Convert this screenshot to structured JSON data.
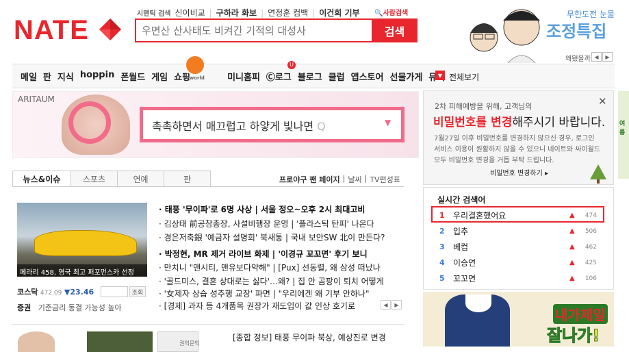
{
  "header": {
    "logo": "NATE",
    "hot_label": "시맨틱 검색",
    "hot_terms": [
      "신이비교",
      "구하라 화보",
      "연정훈 컴백",
      "이건희 기부"
    ],
    "people_search": "사람검색",
    "search_placeholder": "우면산 산사태도 비켜간 기적의 대성사",
    "search_button": "검색"
  },
  "promo": {
    "subtitle": "무한도전 눈물",
    "title": "조정특집",
    "link": "왜됐을까",
    "prev": "◀",
    "next": "▶"
  },
  "nav": {
    "items": [
      "메일",
      "판",
      "지식",
      "hoppin",
      "폰월드",
      "게임",
      "쇼핑",
      "미니홈피",
      "Ⓒ로그",
      "블로그",
      "클럽",
      "앱스토어",
      "선물가게",
      "뮤직"
    ],
    "cyworld_label": "cyworld",
    "blog_badge": "U",
    "all_icon": "▼",
    "all_label": "전체보기"
  },
  "banner": {
    "brand": "ARITAUM",
    "text": "촉촉하면서 매끄럽고 하얗게 빛나면",
    "search_glyph": "Q",
    "caret": "▼"
  },
  "tabs": {
    "items": [
      "뉴스&이슈",
      "스포츠",
      "연예",
      "판"
    ],
    "right": [
      "프로야구 팬 페이지",
      "날씨",
      "TV편성표"
    ]
  },
  "news": {
    "image_caption": "페라리 458, 영국 최고 퍼포먼스카 선정",
    "headlines": [
      "· 태풍 '무이파'로 6명 사상 | 서울 정오~오후 2시 최대고비",
      "· 김상태 前공참총장, 사설비행장 운영 | '플라스틱 탄피' 나온다",
      "· 경은저축銀 '예금자 설명회' 북새통 | 국내 보안SW 北이 만든다?",
      "· 박정현, MR 제거 라이브 화제 | '이경규 꼬꼬면' 후기 보니",
      "· 만치니 \"맨시티, 맨유보다약해\" | [Pux] 선동렬, 왜 삼성 떠났나",
      "· '골드미스, 결혼 상대로는 싫다'…왜? | 집 안 곰팡이 퇴치 어떻게",
      "· '女제자 상습 성추행 교장' 파면 | \"우리에겐 왜 기부 안하나\"",
      "· [경제] 과자 등 4개품목 권장가 재도입이 값 인상 호기로"
    ],
    "prev": "◀",
    "next": "▶"
  },
  "stock": {
    "name": "코스닥",
    "value": "472.09",
    "change": "▼23.46",
    "lookup": "조회",
    "line2_label": "증권",
    "line2_text": "기준금리 동결 가능성 높아"
  },
  "bottom": {
    "thumb_text": "권익문익",
    "headline": "[종합 정보] 태풍 무이파 북상, 예상진로 변경"
  },
  "notice": {
    "close": "✕",
    "line1": "2차 피해예방을 위해, 고객님의",
    "line2_red": "비밀번호를 변경",
    "line2_rest": "해주시기 바랍니다.",
    "body": "7월27일 이후 비밀번호를 변경하지 않으신 경우, 로그인 서비스 이용이 원활하지 않을 수 있으니 네이트와 싸이월드 모두 비밀번호 변경을 거듭 부탁 드립니다.",
    "link": "비밀번호 변경하기 ▸"
  },
  "realtime": {
    "title": "실시간 검색어",
    "items": [
      {
        "rank": "1",
        "name": "우리결혼했어요",
        "arrow": "▲",
        "count": "474"
      },
      {
        "rank": "2",
        "name": "입추",
        "arrow": "▲",
        "count": "506"
      },
      {
        "rank": "3",
        "name": "베컴",
        "arrow": "▲",
        "count": "462"
      },
      {
        "rank": "4",
        "name": "이승연",
        "arrow": "▲",
        "count": "425"
      },
      {
        "rank": "5",
        "name": "꼬꼬면",
        "arrow": "▲",
        "count": "106"
      }
    ]
  },
  "side_ad": {
    "line1": "내가제일",
    "line2": "잘나가!"
  },
  "far_ad": {
    "text": "여름"
  },
  "colors": {
    "brand_red": "#e9262d",
    "link_blue": "#3b7bd4"
  }
}
